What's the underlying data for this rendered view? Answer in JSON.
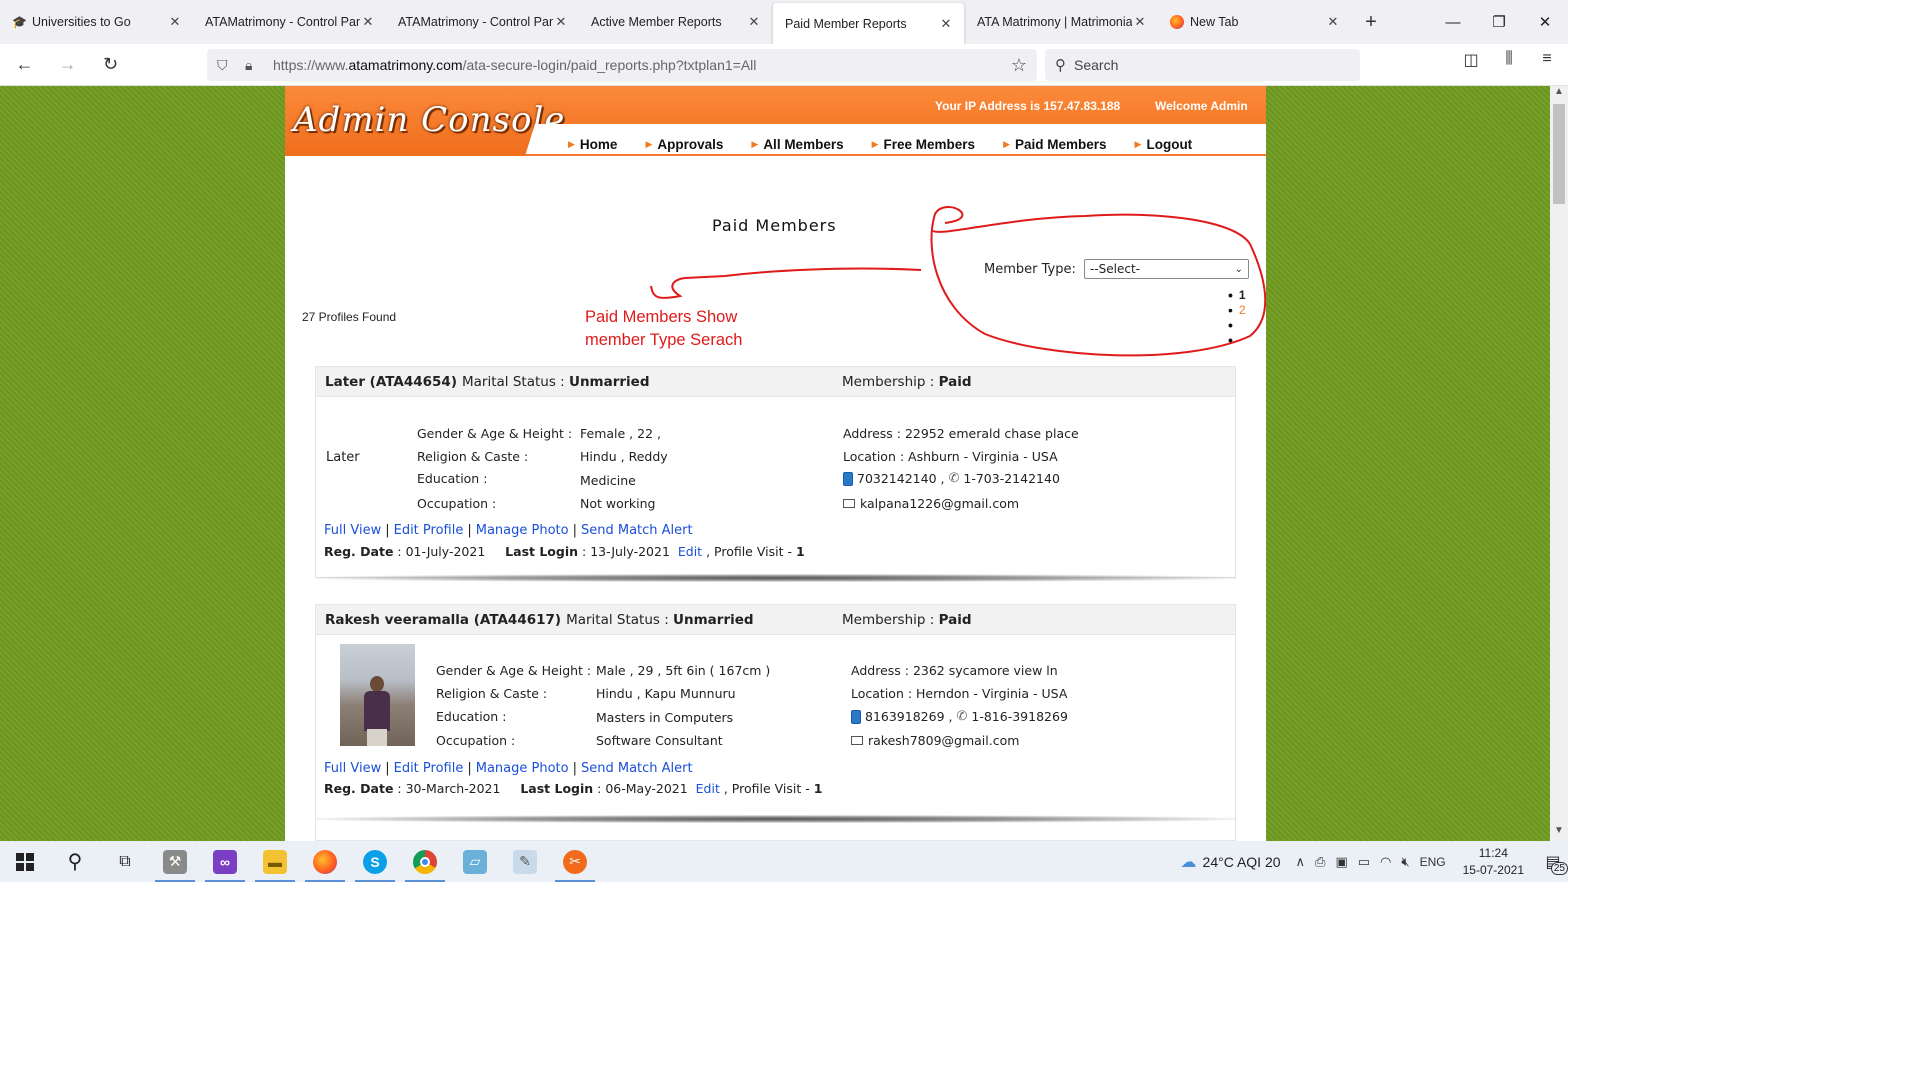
{
  "tabs": [
    {
      "label": "Universities to Go",
      "icon": "graduation-icon"
    },
    {
      "label": "ATAMatrimony - Control Pan",
      "icon": ""
    },
    {
      "label": "ATAMatrimony - Control Pan",
      "icon": ""
    },
    {
      "label": "Active Member Reports",
      "icon": ""
    },
    {
      "label": "Paid Member Reports",
      "icon": "",
      "active": true
    },
    {
      "label": "ATA Matrimony | Matrimonia",
      "icon": ""
    },
    {
      "label": "New Tab",
      "icon": "firefox-icon"
    }
  ],
  "browser": {
    "url_prefix": "https://www.",
    "url_domain": "atamatrimony.com",
    "url_path": "/ata-secure-login/paid_reports.php?txtplan1=All",
    "search_placeholder": "Search"
  },
  "header": {
    "logo": "Admin Console",
    "ip": "Your IP Address is 157.47.83.188",
    "welcome": "Welcome Admin",
    "menu": [
      "Home",
      "Approvals",
      "All Members",
      "Free Members",
      "Paid Members",
      "Logout"
    ]
  },
  "main": {
    "title": "Paid Members",
    "member_type_label": "Member Type:",
    "member_type_selected": "--Select-",
    "pages": [
      "1",
      "2",
      "",
      ""
    ],
    "profiles_found": "27 Profiles Found",
    "annotation_line1": "Paid Members Show",
    "annotation_line2": "member Type Serach"
  },
  "members": [
    {
      "name": "Later (ATA44654)",
      "marital_label": "Marital Status :",
      "marital": "Unmarried",
      "membership_label": "Membership :",
      "membership": "Paid",
      "photo_text": "Later",
      "gender_label": "Gender & Age & Height :",
      "gender": "Female , 22 ,",
      "religion_label": "Religion & Caste :",
      "religion": "Hindu , Reddy",
      "education_label": "Education :",
      "education": "Medicine",
      "occupation_label": "Occupation :",
      "occupation": "Not working",
      "address": "Address : 22952 emerald chase place",
      "location": "Location : Ashburn - Virginia - USA",
      "mobile": "7032142140 ,",
      "phone": "1-703-2142140",
      "email": "kalpana1226@gmail.com",
      "links": [
        "Full View",
        "Edit Profile",
        "Manage Photo",
        "Send Match Alert"
      ],
      "reg_label": "Reg. Date",
      "reg_date": ": 01-July-2021",
      "login_label": "Last Login",
      "login_date": ": 13-July-2021",
      "edit": "Edit",
      "visit_text": ", Profile Visit -",
      "visits": "1"
    },
    {
      "name": "Rakesh veeramalla (ATA44617)",
      "marital_label": "Marital Status :",
      "marital": "Unmarried",
      "membership_label": "Membership :",
      "membership": "Paid",
      "gender_label": "Gender & Age & Height :",
      "gender": "Male , 29 , 5ft 6in ( 167cm )",
      "religion_label": "Religion & Caste :",
      "religion": "Hindu , Kapu Munnuru",
      "education_label": "Education :",
      "education": "Masters in Computers",
      "occupation_label": "Occupation :",
      "occupation": "Software Consultant",
      "address": "Address : 2362 sycamore view ln",
      "location": "Location : Herndon - Virginia - USA",
      "mobile": "8163918269 ,",
      "phone": "1-816-3918269",
      "email": "rakesh7809@gmail.com",
      "links": [
        "Full View",
        "Edit Profile",
        "Manage Photo",
        "Send Match Alert"
      ],
      "reg_label": "Reg. Date",
      "reg_date": ": 30-March-2021",
      "login_label": "Last Login",
      "login_date": ": 06-May-2021",
      "edit": "Edit",
      "visit_text": ", Profile Visit -",
      "visits": "1"
    }
  ],
  "taskbar": {
    "weather": "24°C  AQI 20",
    "lang": "ENG",
    "time": "11:24",
    "date": "15-07-2021",
    "notifications": "25"
  },
  "colors": {
    "orange": "#f37a2c",
    "green_bg": "#6f9b1f",
    "link": "#1a4fd8",
    "annotation": "#e01a1a"
  }
}
